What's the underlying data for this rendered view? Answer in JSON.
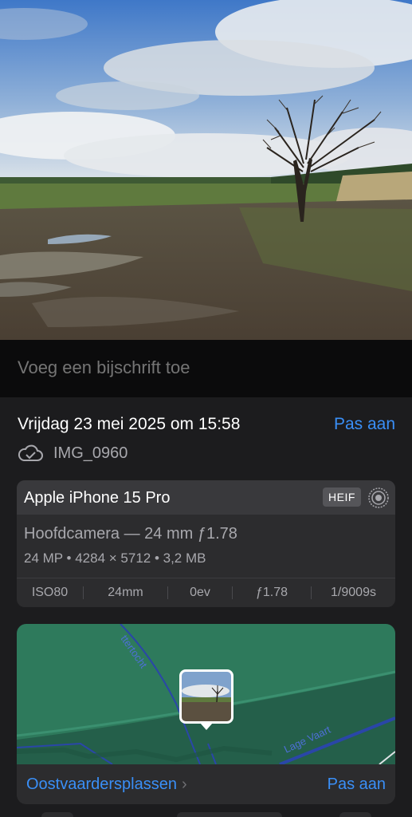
{
  "caption": {
    "placeholder": "Voeg een bijschrift toe"
  },
  "info": {
    "date": "Vrijdag 23 mei 2025 om 15:58",
    "edit_label": "Pas aan",
    "file_name": "IMG_0960"
  },
  "camera": {
    "model": "Apple iPhone 15 Pro",
    "format": "HEIF",
    "lens": "Hoofdcamera — 24 mm ƒ1.78",
    "specs": "24 MP • 4284 × 5712 • 3,2 MB",
    "exif": [
      "ISO80",
      "24mm",
      "0ev",
      "ƒ1.78",
      "1/9009s"
    ]
  },
  "map": {
    "labels": [
      "ttertocht",
      "Lage Vaart"
    ],
    "location": "Oostvaardersplassen",
    "edit_label": "Pas aan"
  },
  "colors": {
    "accent": "#3a8ff7",
    "panel": "#1c1c1e",
    "card": "#2c2c2e",
    "map_green": "#2e7a5c"
  }
}
